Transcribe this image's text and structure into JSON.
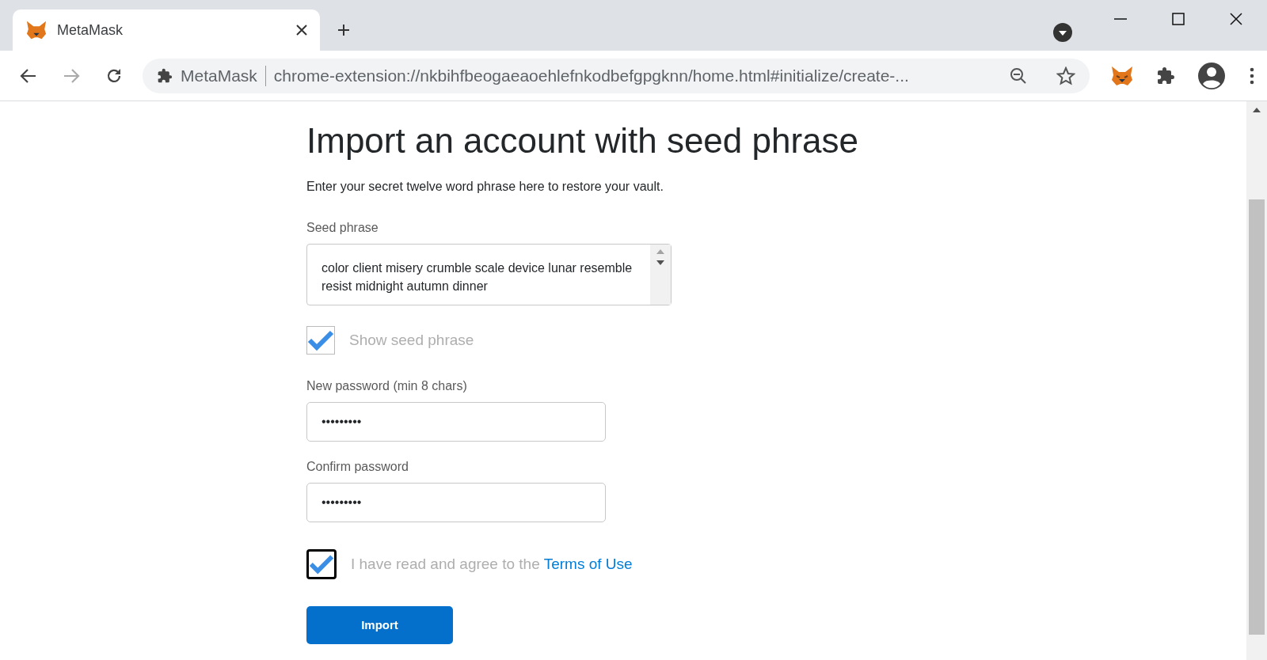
{
  "browser": {
    "tabs": [
      {
        "title": "MetaMask",
        "selected": true
      }
    ],
    "address": {
      "site_label": "MetaMask",
      "url": "chrome-extension://nkbihfbeogaeaoehlefnkodbefgpgknn/home.html#initialize/create-..."
    }
  },
  "page": {
    "heading": "Import an account with seed phrase",
    "description": "Enter your secret twelve word phrase here to restore your vault.",
    "seed_field": {
      "label": "Seed phrase",
      "value": "color client misery crumble scale device lunar resemble resist midnight autumn dinner"
    },
    "show_seed": {
      "label": "Show seed phrase",
      "checked": true
    },
    "password_fields": [
      {
        "label": "New password (min 8 chars)",
        "value": "•••••••••"
      },
      {
        "label": "Confirm password",
        "value": "•••••••••"
      }
    ],
    "terms": {
      "text": "I have read and agree to the",
      "link": "Terms of Use",
      "checked": true,
      "focused": true
    },
    "import_button": "Import"
  }
}
